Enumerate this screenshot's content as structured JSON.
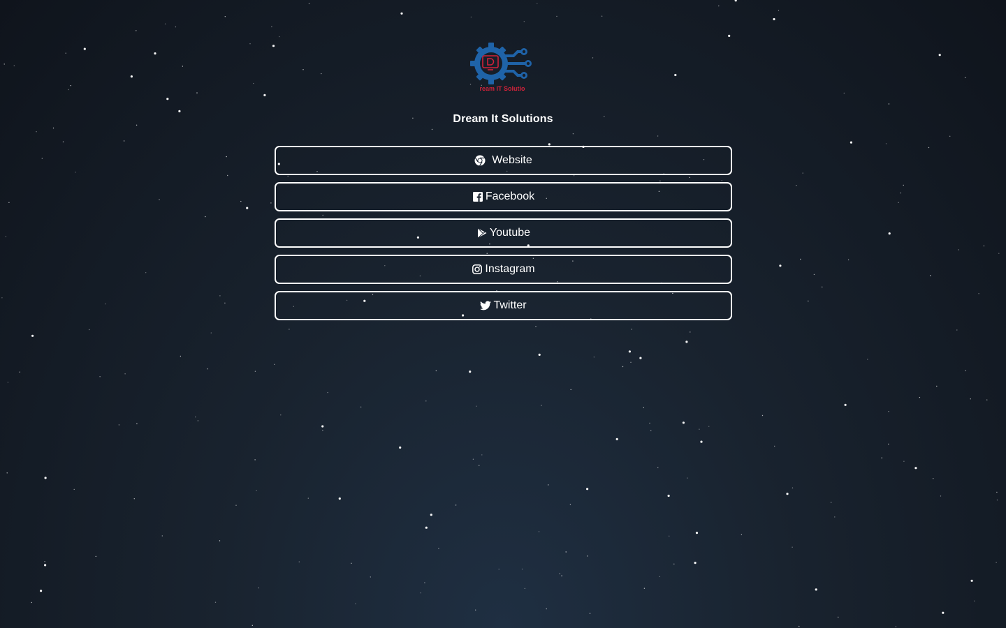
{
  "brand": {
    "name": "Dream It Solutions",
    "logo_text": "ream IT Solutio",
    "colors": {
      "gear_blue": "#1f63a8",
      "accent_red": "#d0223a"
    }
  },
  "links": [
    {
      "label": "Website",
      "icon": "chrome-icon"
    },
    {
      "label": "Facebook",
      "icon": "facebook-icon"
    },
    {
      "label": "Youtube",
      "icon": "play-icon"
    },
    {
      "label": "Instagram",
      "icon": "instagram-icon"
    },
    {
      "label": "Twitter",
      "icon": "twitter-icon"
    }
  ],
  "theme": {
    "background": "#141b25",
    "button_border": "#ffffff",
    "text": "#ffffff"
  }
}
